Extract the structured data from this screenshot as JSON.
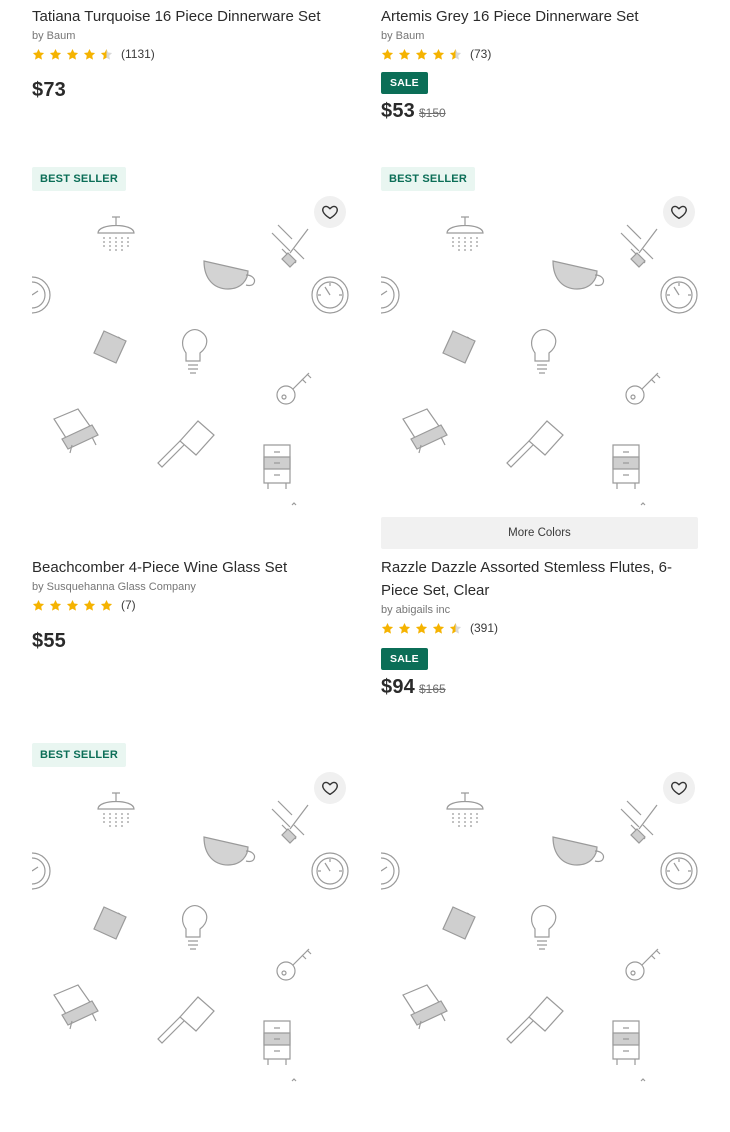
{
  "colors": {
    "star": "#f5b301",
    "sale": "#0b6e57",
    "best_seller_bg": "#e9f6f1",
    "best_seller_text": "#0b6e57"
  },
  "products": [
    {
      "title": "Tatiana Turquoise 16 Piece Dinnerware Set",
      "brand": "by Baum",
      "rating": 4.5,
      "review_count": "(1131)",
      "price": "$73"
    },
    {
      "title": "Artemis Grey 16 Piece Dinnerware Set",
      "brand": "by Baum",
      "rating": 4.5,
      "review_count": "(73)",
      "sale_label": "SALE",
      "price": "$53",
      "old_price": "$150"
    },
    {
      "badge": "BEST SELLER",
      "title": "Beachcomber 4-Piece Wine Glass Set",
      "brand": "by Susquehanna Glass Company",
      "rating": 5,
      "review_count": "(7)",
      "price": "$55",
      "favorite_icon": "heart-outline-icon",
      "image": "placeholder-pattern"
    },
    {
      "badge": "BEST SELLER",
      "more_colors": "More Colors",
      "title": "Razzle Dazzle Assorted Stemless Flutes, 6-Piece Set, Clear",
      "brand": "by abigails inc",
      "rating": 4.5,
      "review_count": "(391)",
      "sale_label": "SALE",
      "price": "$94",
      "old_price": "$165",
      "favorite_icon": "heart-outline-icon",
      "image": "placeholder-pattern"
    },
    {
      "badge": "BEST SELLER",
      "favorite_icon": "heart-outline-icon",
      "image": "placeholder-pattern"
    },
    {
      "favorite_icon": "heart-outline-icon",
      "image": "placeholder-pattern"
    }
  ]
}
